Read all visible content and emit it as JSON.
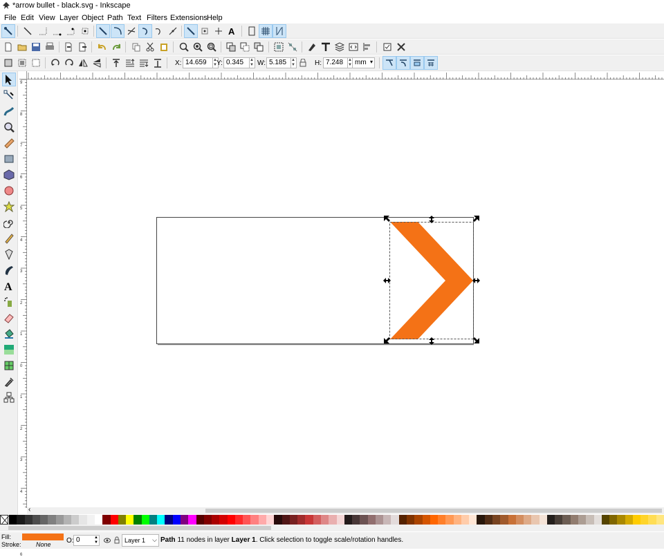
{
  "window": {
    "title": "*arrow bullet - black.svg - Inkscape"
  },
  "menu": [
    "File",
    "Edit",
    "View",
    "Layer",
    "Object",
    "Path",
    "Text",
    "Filters",
    "Extensions",
    "Help"
  ],
  "toolbar_controls": {
    "x_label": "X:",
    "x_value": "14.659",
    "y_label": "Y:",
    "y_value": "0.345",
    "w_label": "W:",
    "w_value": "5.185",
    "h_label": "H:",
    "h_value": "7.248",
    "unit": "mm"
  },
  "status": {
    "fill_label": "Fill:",
    "stroke_label": "Stroke:",
    "stroke_value": "None",
    "opacity_label": "O:",
    "opacity_value": "0",
    "layer_value": "Layer 1",
    "message_type": "Path",
    "message_rest": " 11 nodes in layer ",
    "message_layer": "Layer 1",
    "message_tail": ". Click selection to toggle scale/rotation handles."
  },
  "colors": {
    "fill": "#f47216",
    "selection_accent": "#cce4f7"
  },
  "ruler_marks": {
    "horizontal": [],
    "vertical": [
      "9",
      "8",
      "7",
      "6",
      "5",
      "4",
      "3",
      "2",
      "1",
      "0",
      "1",
      "2",
      "3",
      "4",
      "5",
      "6"
    ]
  },
  "tools": [
    "selector-tool-icon",
    "node-tool-icon",
    "tweak-tool-icon",
    "zoom-tool-icon",
    "measure-tool-icon",
    "rect-tool-icon",
    "3dbox-tool-icon",
    "ellipse-tool-icon",
    "star-tool-icon",
    "spiral-tool-icon",
    "pencil-tool-icon",
    "pen-tool-icon",
    "calligraphy-tool-icon",
    "text-tool-icon",
    "spray-tool-icon",
    "eraser-tool-icon",
    "bucket-tool-icon",
    "gradient-tool-icon",
    "mesh-tool-icon",
    "dropper-tool-icon",
    "connector-tool-icon"
  ],
  "palette": [
    "#000000",
    "#1a1a1a",
    "#333333",
    "#4d4d4d",
    "#666666",
    "#808080",
    "#999999",
    "#b3b3b3",
    "#cccccc",
    "#e6e6e6",
    "#f2f2f2",
    "#ffffff",
    "#800000",
    "#ff0000",
    "#808000",
    "#ffff00",
    "#008000",
    "#00ff00",
    "#008080",
    "#00ffff",
    "#000080",
    "#0000ff",
    "#800080",
    "#ff00ff",
    "#550000",
    "#800000",
    "#aa0000",
    "#d40000",
    "#ff0000",
    "#ff2a2a",
    "#ff5555",
    "#ff8080",
    "#ffaaaa",
    "#ffd5d5",
    "#280b0b",
    "#501616",
    "#782121",
    "#a02c2c",
    "#c83737",
    "#d35f5f",
    "#de8787",
    "#e9afaf",
    "#f4d7d7",
    "#241c1c",
    "#483737",
    "#6c5353",
    "#916f6f",
    "#ac9393",
    "#c8b7b7",
    "#e3dbdb",
    "#552200",
    "#803300",
    "#aa4400",
    "#d45500",
    "#ff6600",
    "#ff7f2a",
    "#ff9955",
    "#ffb380",
    "#ffccaa",
    "#ffe6d5",
    "#28170b",
    "#502d16",
    "#784421",
    "#a05a2c",
    "#c87137",
    "#d38d5f",
    "#deaa87",
    "#e9c6af",
    "#f4e3d7",
    "#241f1c",
    "#483e37",
    "#6c5d53",
    "#917c6f",
    "#ac9d93",
    "#c8beb7",
    "#e3dedb",
    "#554400",
    "#806600",
    "#aa8800",
    "#d4aa00",
    "#ffcc00",
    "#ffd42a",
    "#ffdd55",
    "#ffe680"
  ]
}
